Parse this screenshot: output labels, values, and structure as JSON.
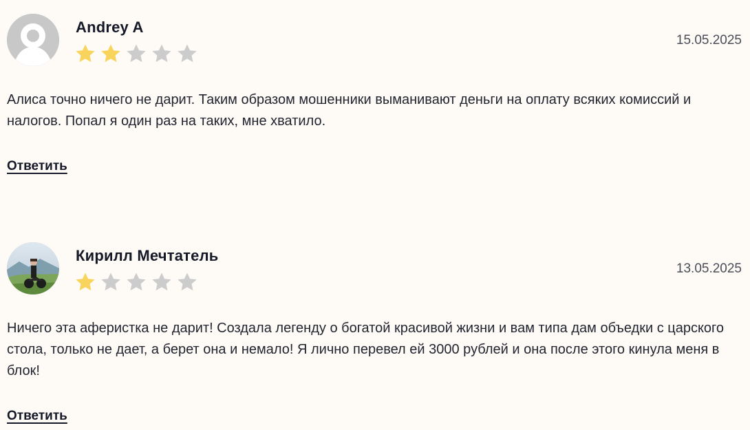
{
  "reviews": [
    {
      "author": "Andrey A",
      "date": "15.05.2025",
      "rating": 2,
      "max_rating": 5,
      "avatar": "default-user-silhouette",
      "text": "Алиса точно ничего не дарит. Таким образом мошенники выманивают деньги на оплату всяких комиссий и налогов. Попал я один раз на таких, мне хватило.",
      "reply_label": "Ответить"
    },
    {
      "author": "Кирилл Мечтатель",
      "date": "13.05.2025",
      "rating": 1,
      "max_rating": 5,
      "avatar": "photo-person-with-motorcycle-mountains",
      "text": "Ничего эта аферистка не дарит! Создала легенду о богатой красивой жизни и вам типа дам объедки с царского стола, только не дает, а берет она и немало! Я лично перевел ей 3000 рублей и она после этого кинула меня в блок!",
      "reply_label": "Ответить"
    }
  ],
  "colors": {
    "background": "#fefbf7",
    "star_filled": "#f9d45c",
    "star_empty": "#cccccc",
    "text": "#22252f",
    "author": "#141827"
  }
}
